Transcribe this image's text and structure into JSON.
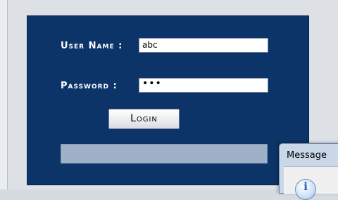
{
  "login": {
    "username_label": "User Name :",
    "username_value": "abc",
    "password_label": "Password :",
    "password_value": "•••",
    "login_button_label": "Login",
    "status_text": ""
  },
  "message_dialog": {
    "title": "Message",
    "icon": "info-icon"
  },
  "colors": {
    "panel_background": "#0d3468",
    "status_bar": "#9fb1c8",
    "dialog_title_bar": "#c9d7e8"
  }
}
